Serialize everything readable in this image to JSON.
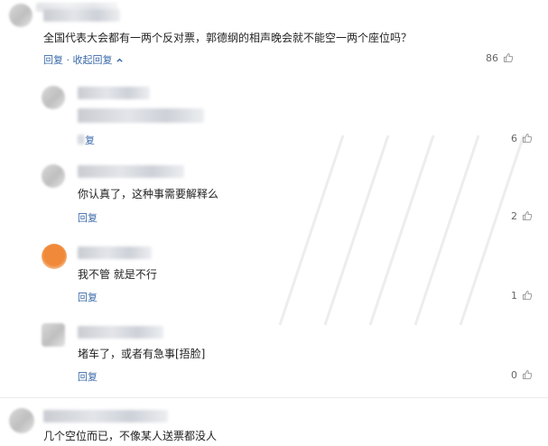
{
  "comments": [
    {
      "text": "全国代表大会都有一两个反对票，郭德纲的相声晚会就不能空一两个座位吗？",
      "reply_label": "回复",
      "collapse_label": "收起回复",
      "likes": "86"
    },
    {
      "text": "",
      "reply_label": "复",
      "likes": "6"
    },
    {
      "text": "你认真了，这种事需要解释么",
      "reply_label": "回复",
      "likes": "2"
    },
    {
      "text": "我不管 就是不行",
      "reply_label": "回复",
      "likes": "1"
    },
    {
      "text": "堵车了，或者有急事[捂脸]",
      "reply_label": "回复",
      "likes": "0"
    },
    {
      "text": "几个空位而已，不像某人送票都没人",
      "reply_label": "",
      "likes": ""
    }
  ],
  "separator": "·",
  "icons": {
    "like": "thumbs-up-icon",
    "collapse": "chevron-up-icon"
  },
  "colors": {
    "link": "#3b6aa8",
    "text": "#222222",
    "muted": "#666666"
  }
}
